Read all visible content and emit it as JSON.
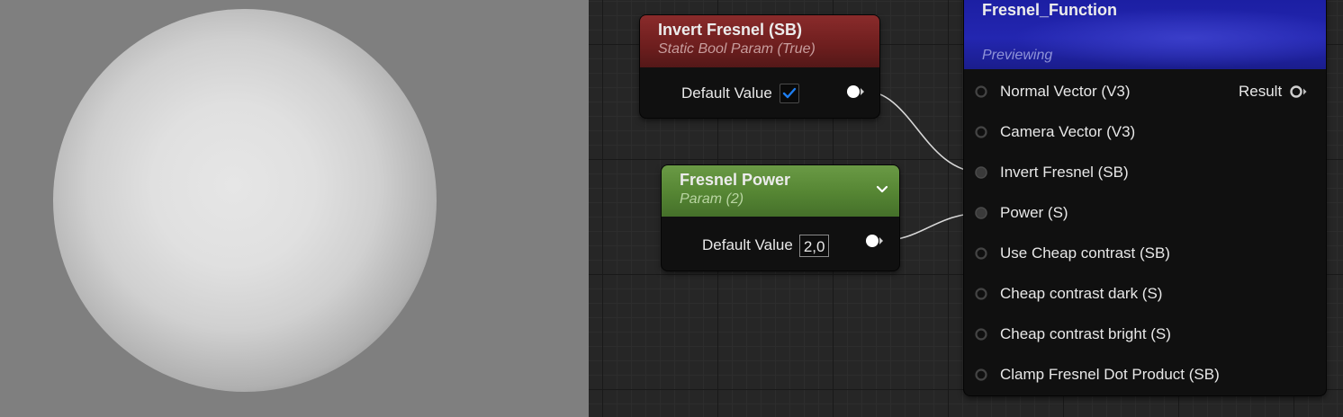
{
  "preview": {
    "shape": "sphere"
  },
  "nodes": {
    "invert_fresnel": {
      "title": "Invert Fresnel (SB)",
      "subtitle": "Static Bool Param (True)",
      "default_label": "Default Value",
      "checked": true,
      "header_color": "#7a2424"
    },
    "fresnel_power": {
      "title": "Fresnel Power",
      "subtitle": "Param (2)",
      "default_label": "Default Value",
      "value": "2,0",
      "header_color": "#5a8a37"
    },
    "fresnel_function": {
      "title": "Fresnel_Function",
      "subtitle": "Previewing",
      "header_color": "#1f22a8",
      "output_label": "Result",
      "inputs": [
        {
          "label": "Normal Vector (V3)",
          "connected": false
        },
        {
          "label": "Camera Vector (V3)",
          "connected": false
        },
        {
          "label": "Invert Fresnel (SB)",
          "connected": true
        },
        {
          "label": "Power (S)",
          "connected": true
        },
        {
          "label": "Use Cheap contrast (SB)",
          "connected": false
        },
        {
          "label": "Cheap contrast dark (S)",
          "connected": false
        },
        {
          "label": "Cheap contrast bright (S)",
          "connected": false
        },
        {
          "label": "Clamp Fresnel Dot Product (SB)",
          "connected": false
        }
      ]
    }
  },
  "colors": {
    "grid_background": "#262626",
    "node_body": "#101010",
    "wire": "#d8d8d8",
    "checkbox_tick": "#1e7ef0"
  }
}
